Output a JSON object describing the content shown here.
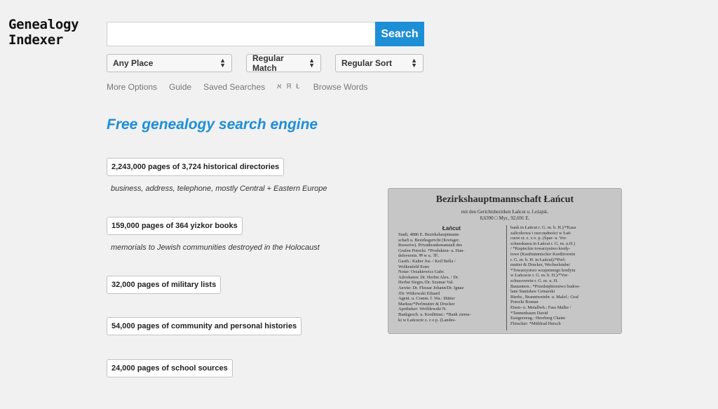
{
  "logo": {
    "line1": "Genealogy",
    "line2": "Indexer"
  },
  "search": {
    "value": "",
    "placeholder": "",
    "button_label": "Search"
  },
  "selects": {
    "place": "Any Place",
    "match": "Regular Match",
    "sort": "Regular Sort"
  },
  "links": {
    "more_options": "More Options",
    "guide": "Guide",
    "saved_searches": "Saved Searches",
    "hebrew_cyrillic_polish": "א Я Ł",
    "browse_words": "Browse Words"
  },
  "tagline": "Free genealogy search engine",
  "stats": [
    {
      "label": "2,243,000 pages of 3,724 historical directories",
      "description": "business, address, telephone, mostly Central + Eastern Europe"
    },
    {
      "label": "159,000 pages of 364 yizkor books",
      "description": "memorials to Jewish communities destroyed in the Holocaust"
    },
    {
      "label": "32,000 pages of military lists",
      "description": ""
    },
    {
      "label": "54,000 pages of community and personal histories",
      "description": ""
    },
    {
      "label": "24,000 pages of school sources",
      "description": ""
    }
  ],
  "document": {
    "title": "Bezirkshauptmannschaft Łańcut",
    "subtitle1": "mit den Gerichtsbezirken Łańcut u. Leżajsk.",
    "subtitle2": "8,6390 □ Myr., 92,691 E.",
    "left_heading": "Łańcut",
    "left_lines": [
      "Stadt, 4886 E. Bezirkshauptmann-",
      "schaft u. Bezirksgericht (Kreisger.",
      "Rzeszów). Privatkrankenanstalt des",
      "Grafen Potocki. *Produkten- u. Han-",
      "delsverein. ✉ w u. ☏.",
      "Gasth.: Kalter Jos. / Keil Bella /",
      "Wolkenfeld Ester",
      "Notar: Orzakiewicz Gabr.",
      "Advokaten: Dr. Herbst Alex. / Dr.",
      "Herbst Siegm./Dr. Szumar Val.",
      "Aerzte: Dr. Flessar Johann/Dr. Ignaz",
      "/Dr. Witkowski Eduard",
      "Agent. u. Comm. f. Wa.: Hütter",
      "Markus/*Perlmutter & Drucker",
      "Apotheker: Wróblewski N.",
      "Bankgesch. u. Kreditinst.: *Bank ziems-",
      "ki w Łańcucie z. z o p. (Landes-"
    ],
    "right_lines": [
      "bank in Łańcut r. G. m. b. H.)/*Kasa",
      "zaliczkowa i oszczędności w Łań-",
      "cucie st. z. z o. p. (Spar- u. Vor-",
      "schusskassa in Łańcut r. G. m. u.H.)",
      "/ *Kupieckie towarzystwo kredy-",
      "towe (Kaufmännischer Kreditverein",
      "r. G. m. b. H. in Łańcut)/*Perl-",
      "mutter & Drucker, Wechselstube/",
      "*Towarzystwo wzajemnego kredytu",
      "w Łańcucie r. G. m. b. H.)/*Vor-",
      "schussverein r. G. m. u. H.",
      "Bauuntern.: *Przedsiębiorstwo budow-",
      "lane Stanisław Cetnarski",
      "Bierbr., Branntweinbr. u. Malzf.: Graf",
      "Potocki Roman",
      "Eisen- u. Metallwh.: Fass Malke /",
      "*Tannenbaum David",
      "Essigerzeug.: Herzberg Chaim",
      "Fleischer: *Mühlrad Hersch"
    ]
  }
}
